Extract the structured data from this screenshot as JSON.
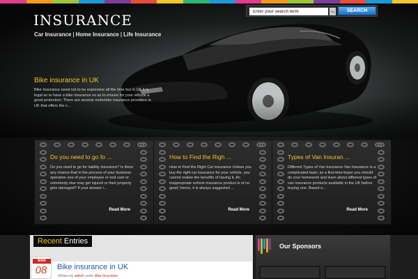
{
  "colors": {
    "accent_yellow": "#f4c52a",
    "link_blue": "#1c58a8",
    "date_red": "#cc2b20",
    "color_strip": [
      "#e23b8f",
      "#f39a1c",
      "#9bc53d",
      "#1d9ad6",
      "#7b3f9a",
      "#e84c3d",
      "#f4c52a",
      "#2bb673",
      "#1d9ad6",
      "#e23b8f",
      "#f39a1c",
      "#9bc53d",
      "#7b3f9a",
      "#e84c3d",
      "#1d9ad6",
      "#f4c52a"
    ]
  },
  "header": {
    "site_title": "INSURANCE",
    "nav": [
      {
        "label": "Car Insurance"
      },
      {
        "label": "Home Insurance"
      },
      {
        "label": "Life Insurance"
      }
    ],
    "search": {
      "placeholder": "Enter your search term",
      "go_label": "Go",
      "button_label": "SEARCH"
    }
  },
  "featured": {
    "title": "Bike insurance in UK",
    "excerpt": "Bike Insurance need not to be expensive all the time but in UK it is legal so to have a bike insurance so as to ensure for your vehicle a good protection. There are several motorbike insurance providers in UK that offers the c..."
  },
  "cards": [
    {
      "title": "Do you need to go fo ...",
      "text": "Do you need to go for liability insurance? Is there any chance that in the process of your business operation one of your employee or end user or somebody else may get injured or their property gets damaged? If your answer i...",
      "read_more": "Read More"
    },
    {
      "title": "How to Find the Righ ...",
      "text": "How to Find the Right Car Insurance Unless you buy the right car insurance for your vehicle, you cannot realize the benefits of having it. An inappropriate vehicle insurance product is of no good; hence, it is always suggested ...",
      "read_more": "Read More"
    },
    {
      "title": "Types of Van Insuran ...",
      "text": "Different Types of Van Insurance  Van Insurance is a complicated topic; as a first-time-buyer you should do your homework and learn about different types of van insurance products available in the UK before buying one. Based o...",
      "read_more": "Read More"
    }
  ],
  "recent": {
    "heading_word1": "Recent",
    "heading_word2": "Entries",
    "entry": {
      "month": "MAR",
      "day": "08",
      "title": "Bike insurance in UK",
      "meta_written_by": "Written by",
      "author": "admin",
      "meta_under": "under",
      "category": "Bike Insurance"
    }
  },
  "sponsors": {
    "title": "Our Sponsors"
  }
}
